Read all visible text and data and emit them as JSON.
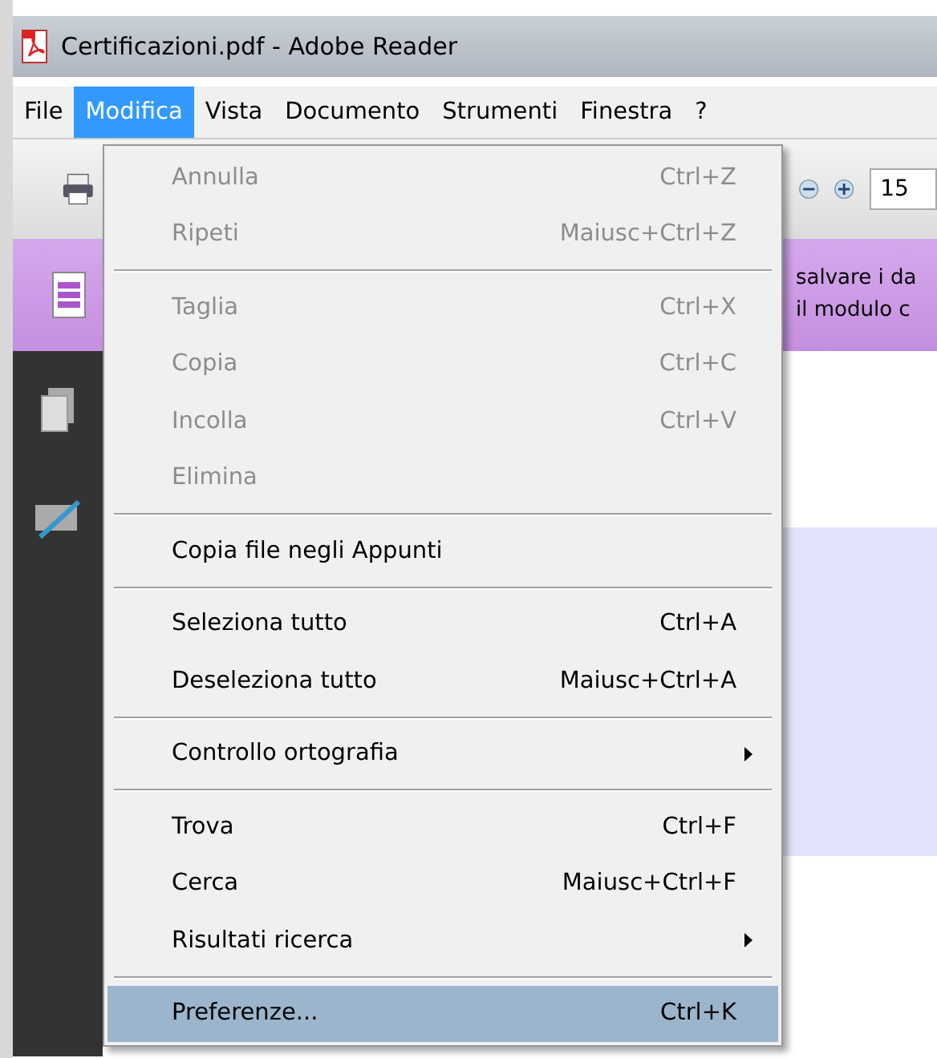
{
  "window": {
    "title": "Certificazioni.pdf - Adobe Reader"
  },
  "menubar": [
    {
      "label": "File",
      "selected": false
    },
    {
      "label": "Modifica",
      "selected": true
    },
    {
      "label": "Vista",
      "selected": false
    },
    {
      "label": "Documento",
      "selected": false
    },
    {
      "label": "Strumenti",
      "selected": false
    },
    {
      "label": "Finestra",
      "selected": false
    },
    {
      "label": "?",
      "selected": false
    }
  ],
  "toolbar": {
    "zoom_value": "15"
  },
  "notice": {
    "lines": [
      "salvare i da",
      "il modulo c"
    ]
  },
  "menu": [
    {
      "kind": "item",
      "label": "Annulla",
      "shortcut": "Ctrl+Z",
      "disabled": true,
      "selected": false,
      "submenu": false
    },
    {
      "kind": "item",
      "label": "Ripeti",
      "shortcut": "Maiusc+Ctrl+Z",
      "disabled": true,
      "selected": false,
      "submenu": false
    },
    {
      "kind": "separator"
    },
    {
      "kind": "item",
      "label": "Taglia",
      "shortcut": "Ctrl+X",
      "disabled": true,
      "selected": false,
      "submenu": false
    },
    {
      "kind": "item",
      "label": "Copia",
      "shortcut": "Ctrl+C",
      "disabled": true,
      "selected": false,
      "submenu": false
    },
    {
      "kind": "item",
      "label": "Incolla",
      "shortcut": "Ctrl+V",
      "disabled": true,
      "selected": false,
      "submenu": false
    },
    {
      "kind": "item",
      "label": "Elimina",
      "disabled": true,
      "selected": false,
      "submenu": false
    },
    {
      "kind": "separator"
    },
    {
      "kind": "item",
      "label": "Copia file negli Appunti",
      "disabled": false,
      "selected": false,
      "submenu": false
    },
    {
      "kind": "separator"
    },
    {
      "kind": "item",
      "label": "Seleziona tutto",
      "shortcut": "Ctrl+A",
      "disabled": false,
      "selected": false,
      "submenu": false
    },
    {
      "kind": "item",
      "label": "Deseleziona tutto",
      "shortcut": "Maiusc+Ctrl+A",
      "disabled": false,
      "selected": false,
      "submenu": false
    },
    {
      "kind": "separator"
    },
    {
      "kind": "item",
      "label": "Controllo ortografia",
      "disabled": false,
      "selected": false,
      "submenu": true
    },
    {
      "kind": "separator"
    },
    {
      "kind": "item",
      "label": "Trova",
      "shortcut": "Ctrl+F",
      "disabled": false,
      "selected": false,
      "submenu": false
    },
    {
      "kind": "item",
      "label": "Cerca",
      "shortcut": "Maiusc+Ctrl+F",
      "disabled": false,
      "selected": false,
      "submenu": false
    },
    {
      "kind": "item",
      "label": "Risultati ricerca",
      "disabled": false,
      "selected": false,
      "submenu": true
    },
    {
      "kind": "separator"
    },
    {
      "kind": "item",
      "label": "Preferenze...",
      "shortcut": "Ctrl+K",
      "disabled": false,
      "selected": true,
      "submenu": false
    }
  ]
}
